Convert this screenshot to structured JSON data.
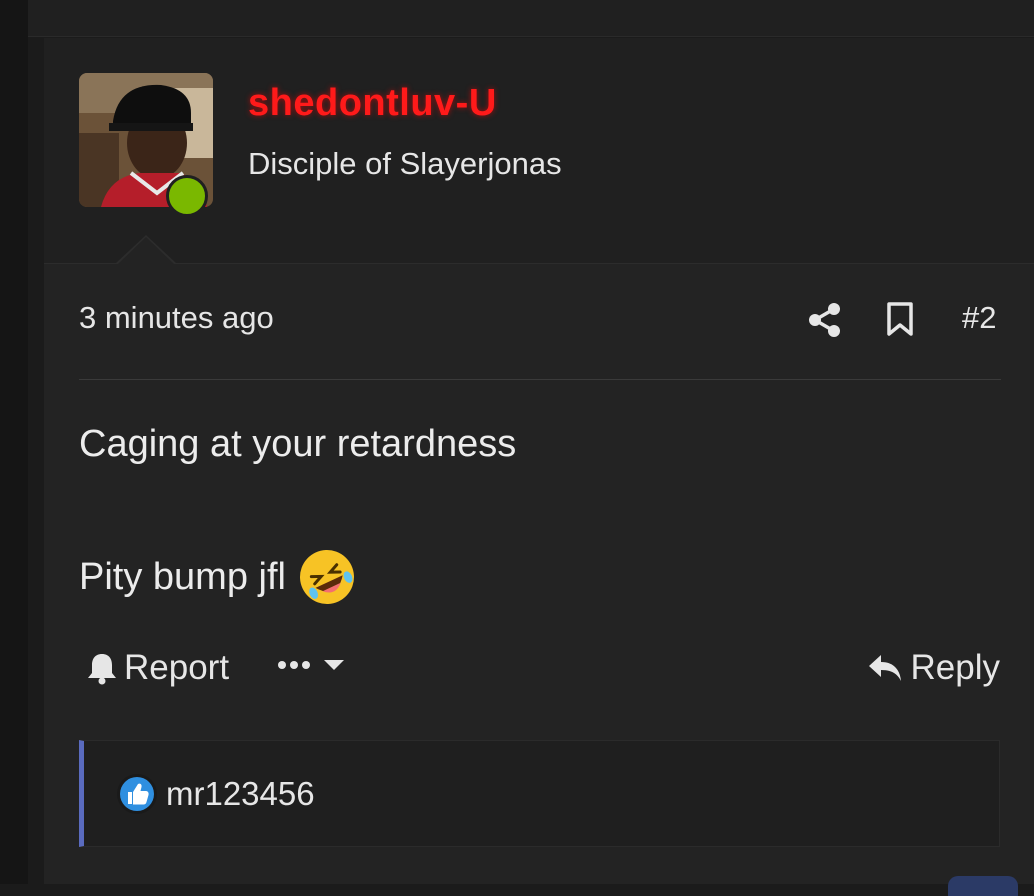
{
  "post": {
    "username": "shedontluv-U",
    "user_title": "Disciple of Slayerjonas",
    "time": "3 minutes ago",
    "post_number": "#2",
    "message_line1": "Caging at your retardness",
    "message_line2": "Pity bump jfl",
    "emoji": "rolling-on-floor-laughing-emoji",
    "online_color": "#7ab800",
    "username_color": "#ff1a1a"
  },
  "actions": {
    "report_label": "Report",
    "reply_label": "Reply"
  },
  "reactions": {
    "reactor": "mr123456",
    "reaction_icon": "like-icon",
    "accent_color": "#5a6bbf"
  }
}
